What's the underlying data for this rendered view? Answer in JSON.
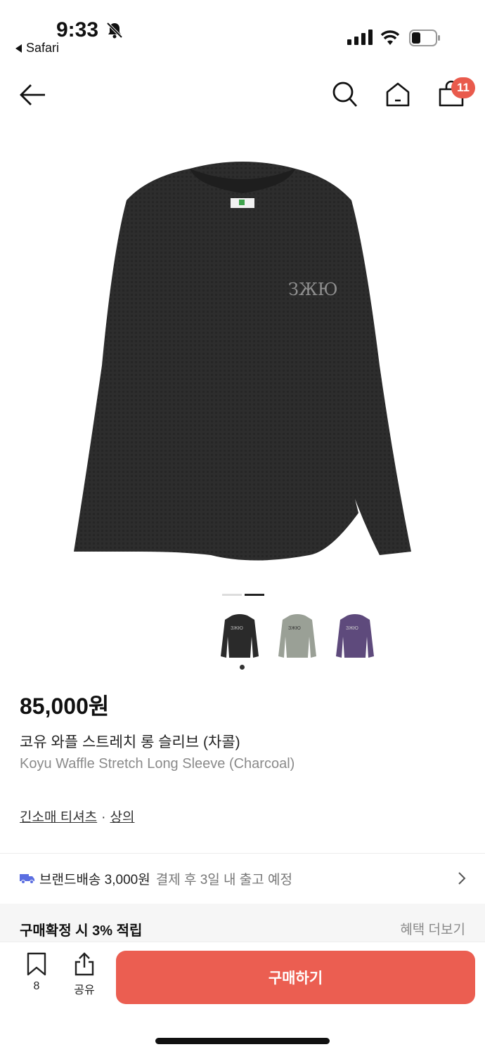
{
  "status": {
    "time": "9:33",
    "back_app": "Safari"
  },
  "nav": {
    "cart_count": "11"
  },
  "product": {
    "price": "85,000원",
    "name_ko": "코유 와플 스트레치 롱 슬리브 (차콜)",
    "name_en": "Koyu Waffle Stretch Long Sleeve (Charcoal)",
    "category_primary": "긴소매 티셔츠",
    "category_sep": "·",
    "category_secondary": "상의",
    "thumbnails": [
      {
        "color_name": "charcoal",
        "color": "#2a2a2a"
      },
      {
        "color_name": "sage",
        "color": "#9aa096"
      },
      {
        "color_name": "purple",
        "color": "#5e4a7c"
      }
    ]
  },
  "shipping": {
    "label": "브랜드배송 3,000원",
    "note": "결제 후 3일 내 출고 예정"
  },
  "points": {
    "label": "구매확정 시 3% 적립",
    "more": "혜택 더보기"
  },
  "bottom": {
    "bookmark_count": "8",
    "share_label": "공유",
    "buy_label": "구매하기"
  },
  "colors": {
    "accent": "#eb5e51",
    "badge": "#e95a4c"
  }
}
